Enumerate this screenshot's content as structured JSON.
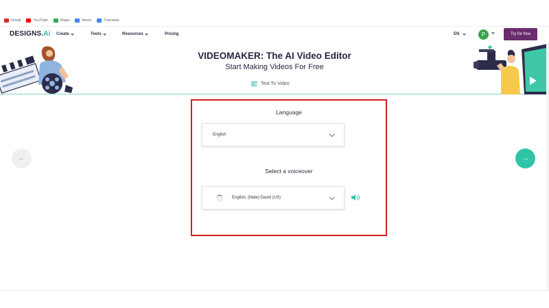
{
  "bookmarks": [
    {
      "label": "Gmail",
      "icon": "gmail-icon",
      "color": "#d93025"
    },
    {
      "label": "YouTube",
      "icon": "youtube-icon",
      "color": "#ff0000"
    },
    {
      "label": "Maps",
      "icon": "maps-icon",
      "color": "#34a853"
    },
    {
      "label": "News",
      "icon": "news-icon",
      "color": "#4285f4"
    },
    {
      "label": "Translate",
      "icon": "translate-icon",
      "color": "#4285f4"
    }
  ],
  "header": {
    "logo_main": "DESIGNS.",
    "logo_accent": "Ai",
    "nav": {
      "create": "Create",
      "tools": "Tools",
      "resources": "Resources",
      "pricing": "Pricing"
    },
    "language": "EN",
    "avatar_letter": "P",
    "try_button": "Try for free"
  },
  "hero": {
    "title": "VIDEOMAKER: The AI Video Editor",
    "subtitle": "Start Making Videos For Free",
    "mode_label": "Text To Video"
  },
  "form": {
    "language_label": "Language",
    "language_value": "English",
    "voice_label": "Select a voiceover",
    "voice_value": "English, (Male) David (US)"
  },
  "colors": {
    "accent": "#2ec4a5",
    "brand_button": "#6a2c6f",
    "highlight_frame": "#d0201f"
  }
}
